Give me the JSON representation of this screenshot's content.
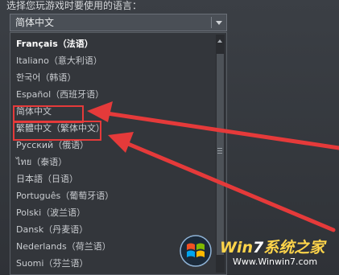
{
  "prompt": {
    "text": "选择您玩游戏时要使用的语言："
  },
  "select": {
    "value": "简体中文"
  },
  "dropdown": {
    "items": [
      {
        "label": "Français（法语）",
        "selected": true
      },
      {
        "label": "Italiano（意大利语）",
        "selected": false
      },
      {
        "label": "한국어（韩语）",
        "selected": false
      },
      {
        "label": "Español（西班牙语）",
        "selected": false
      },
      {
        "label": "简体中文",
        "selected": false
      },
      {
        "label": "繁體中文（繁体中文）",
        "selected": false
      },
      {
        "label": "Русский（俄语）",
        "selected": false
      },
      {
        "label": "ไทย（泰语）",
        "selected": false
      },
      {
        "label": "日本語（日语）",
        "selected": false
      },
      {
        "label": "Português（葡萄牙语）",
        "selected": false
      },
      {
        "label": "Polski（波兰语）",
        "selected": false
      },
      {
        "label": "Dansk（丹麦语）",
        "selected": false
      },
      {
        "label": "Nederlands（荷兰语）",
        "selected": false
      },
      {
        "label": "Suomi（芬兰语）",
        "selected": false
      }
    ]
  },
  "annotations": {
    "color": "#e53a3a"
  },
  "watermark": {
    "title_prefix": "Win",
    "title_num": "7",
    "title_suffix": "系统之家",
    "url": "Www.Winwin7.com"
  }
}
